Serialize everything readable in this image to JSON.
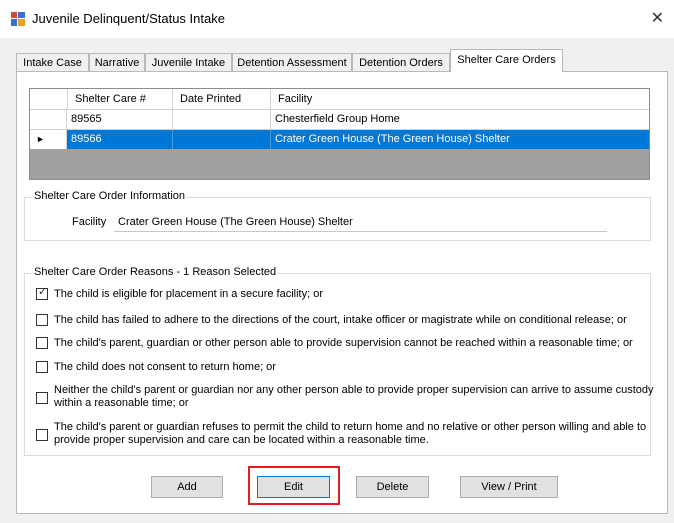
{
  "window": {
    "title": "Juvenile Delinquent/Status Intake",
    "close_glyph": "✕",
    "app_icon": "form-app-icon"
  },
  "tabs": [
    {
      "label": "Intake Case"
    },
    {
      "label": "Narrative"
    },
    {
      "label": "Juvenile Intake"
    },
    {
      "label": "Detention Assessment"
    },
    {
      "label": "Detention Orders"
    },
    {
      "label": "Shelter Care Orders",
      "active": true
    }
  ],
  "grid": {
    "columns": [
      "Shelter Care #",
      "Date Printed",
      "Facility"
    ],
    "rows": [
      {
        "number": "89565",
        "date_printed": "",
        "facility": "Chesterfield Group Home"
      },
      {
        "number": "89566",
        "date_printed": "",
        "facility": "Crater Green House (The Green House) Shelter",
        "selected": true
      }
    ],
    "row_indicator": "►"
  },
  "order_info": {
    "legend": "Shelter Care Order Information",
    "facility_label": "Facility",
    "facility_value": "Crater Green House (The Green House) Shelter"
  },
  "reasons": {
    "legend": "Shelter Care Order Reasons - 1 Reason Selected",
    "items": [
      {
        "text": "The child is eligible for placement in a secure facility; or",
        "checked": true
      },
      {
        "text": "The child has failed to adhere to the directions of the court, intake officer or magistrate while on conditional release; or",
        "checked": false
      },
      {
        "text": "The child's parent, guardian or other person able to provide supervision cannot be reached within a reasonable time; or",
        "checked": false
      },
      {
        "text": "The child does not consent to return home; or",
        "checked": false
      },
      {
        "text": "Neither the child's parent or guardian nor any other person able to provide proper supervision can arrive to assume custody",
        "text2": "within a reasonable time; or",
        "checked": false
      },
      {
        "text": "The child's parent or guardian refuses to permit the child to return home and no relative or other person willing and able to",
        "text2": "provide proper supervision and care can be located within a reasonable time.",
        "checked": false
      }
    ]
  },
  "buttons": {
    "add": "Add",
    "edit": "Edit",
    "delete": "Delete",
    "view_print": "View / Print"
  },
  "colors": {
    "selection": "#0078d7",
    "highlight": "#e21d1d"
  }
}
